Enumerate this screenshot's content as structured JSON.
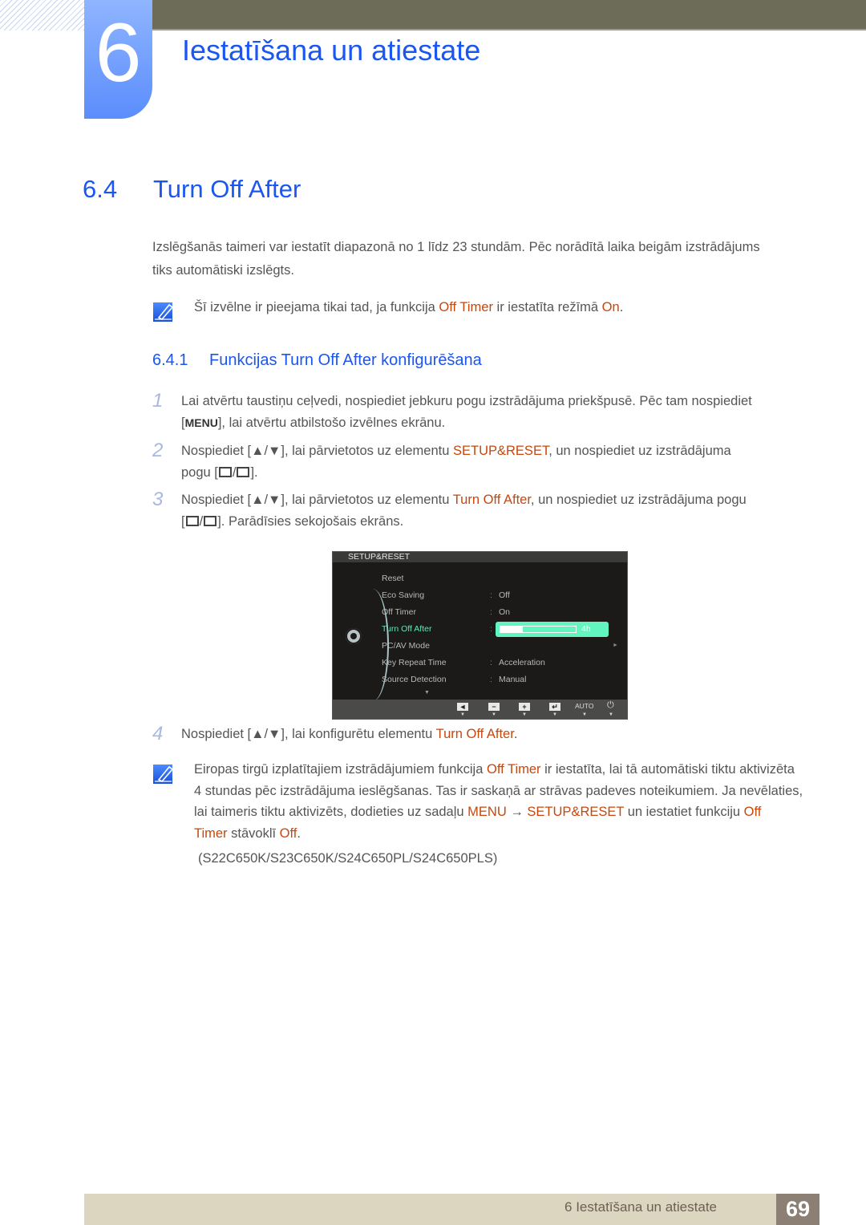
{
  "chapter": {
    "number": "6",
    "title": "Iestatīšana un atiestate"
  },
  "section": {
    "number": "6.4",
    "title": "Turn Off After",
    "intro_line1": "Izslēgšanās taimeri var iestatīt diapazonā no 1 līdz 23 stundām. Pēc norādītā laika beigām izstrādājums",
    "intro_line2": "tiks automātiski izslēgts.",
    "note1": {
      "icon": "note-pencil-icon",
      "t1": "Šī izvēlne ir pieejama tikai tad, ja funkcija ",
      "h1": "Off Timer",
      "t2": " ir iestatīta režīmā ",
      "h2": "On",
      "t3": "."
    }
  },
  "subsection": {
    "number": "6.4.1",
    "title": "Funkcijas Turn Off After konfigurēšana"
  },
  "steps": [
    {
      "num": "1",
      "l1": "Lai atvērtu taustiņu ceļvedi, nospiediet jebkuru pogu izstrādājuma priekšpusē. Pēc tam nospiediet",
      "l2a": "[",
      "l2key": "MENU",
      "l2b": "], lai atvērtu atbilstošo izvēlnes ekrānu."
    },
    {
      "num": "2",
      "t1": "Nospiediet [▲/▼], lai pārvietotos uz elementu ",
      "h1": "SETUP&RESET",
      "t2": ", un nospiediet uz izstrādājuma",
      "l2a": "pogu [",
      "l2b": "]."
    },
    {
      "num": "3",
      "t1": "Nospiediet [▲/▼], lai pārvietotos uz elementu ",
      "h1": "Turn Off After",
      "t2": ", un nospiediet uz izstrādājuma pogu",
      "l2a": "[",
      "l2b": "]. Parādīsies sekojošais ekrāns."
    },
    {
      "num": "4",
      "t1": "Nospiediet [▲/▼], lai konfigurētu elementu ",
      "h1": "Turn Off After",
      "t2": "."
    }
  ],
  "osd": {
    "header": "SETUP&RESET",
    "items": [
      {
        "label": "Reset",
        "value": ""
      },
      {
        "label": "Eco Saving",
        "value": "Off"
      },
      {
        "label": "Off Timer",
        "value": "On"
      },
      {
        "label": "Turn Off After",
        "value": "4h",
        "selected": true,
        "slider_fraction": 0.3
      },
      {
        "label": "PC/AV Mode",
        "value": "",
        "submenu": true
      },
      {
        "label": "Key Repeat Time",
        "value": "Acceleration"
      },
      {
        "label": "Source Detection",
        "value": "Manual"
      }
    ],
    "colon": ":",
    "more_indicator": "▼",
    "submenu_indicator": "►",
    "buttons": [
      {
        "name": "left-button",
        "glyph": "◄"
      },
      {
        "name": "minus-button",
        "glyph": "−"
      },
      {
        "name": "plus-button",
        "glyph": "+"
      },
      {
        "name": "enter-button",
        "glyph": "↵"
      },
      {
        "name": "auto-button",
        "glyph": "AUTO"
      },
      {
        "name": "power-button",
        "glyph": "⏻"
      }
    ],
    "button_indicator": "▼"
  },
  "note2": {
    "l1a": "Eiropas tirgū izplatītajiem izstrādājumiem funkcija ",
    "l1h": "Off Timer",
    "l1b": " ir iestatīta, lai tā automātiski tiktu aktivizēta",
    "l2": "4 stundas pēc izstrādājuma ieslēgšanas. Tas ir saskaņā ar strāvas padeves noteikumiem. Ja nevēlaties,",
    "l3a": "lai taimeris tiktu aktivizēts, dodieties uz sadaļu ",
    "l3h1": "MENU",
    "l3arrow": " → ",
    "l3h2": "SETUP&RESET",
    "l3b": " un iestatiet funkciju ",
    "l3h3": "Off",
    "l4h1": "Timer",
    "l4a": " stāvoklī ",
    "l4h2": "Off",
    "l4b": ".",
    "models": "(S22C650K/S23C650K/S24C650PL/S24C650PLS)"
  },
  "footer": {
    "chapter_label": "6 Iestatīšana un atiestate",
    "page": "69"
  },
  "colors": {
    "accent_blue": "#1a56f0",
    "highlight_orange": "#c8470a",
    "osd_selected": "#63f5c0",
    "top_bar": "#6d6c58",
    "footer_bar": "#dcd5c0",
    "footer_page": "#8c7f74"
  }
}
